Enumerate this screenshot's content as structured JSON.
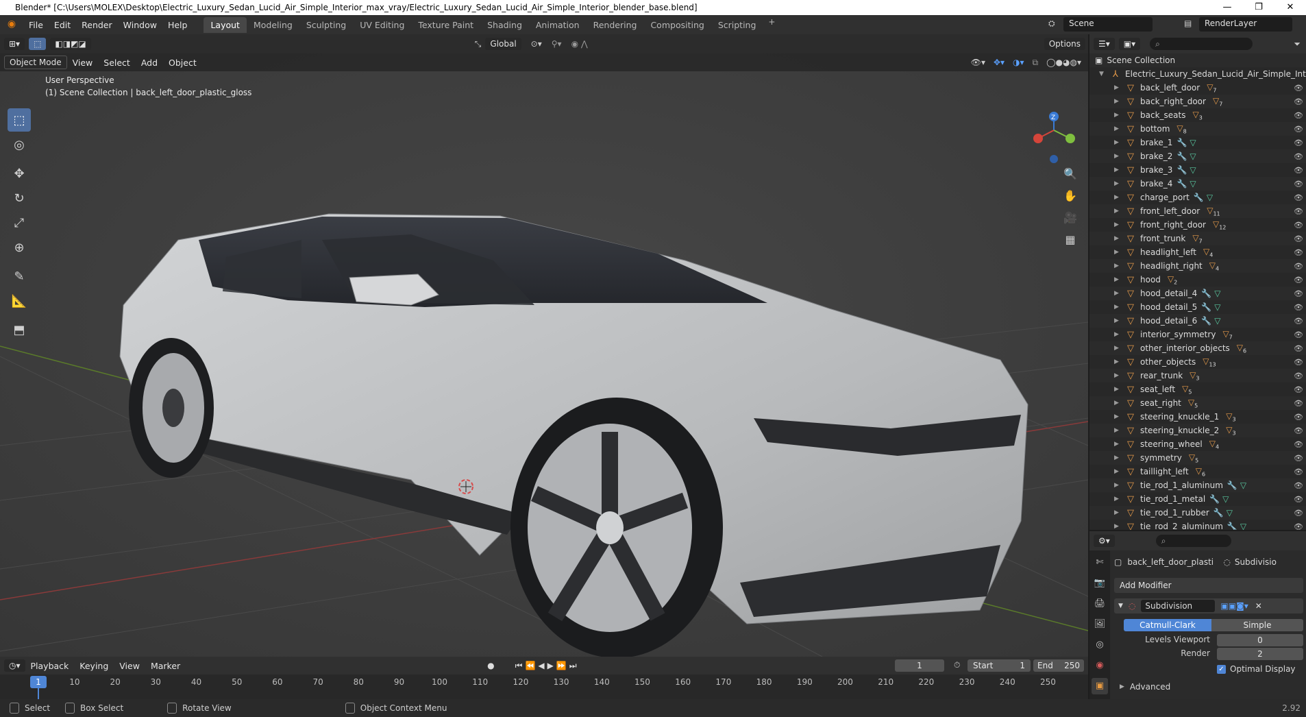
{
  "window": {
    "title": "Blender* [C:\\Users\\MOLEX\\Desktop\\Electric_Luxury_Sedan_Lucid_Air_Simple_Interior_max_vray/Electric_Luxury_Sedan_Lucid_Air_Simple_Interior_blender_base.blend]",
    "controls": [
      "—",
      "❐",
      "✕"
    ]
  },
  "menu": [
    "File",
    "Edit",
    "Render",
    "Window",
    "Help"
  ],
  "workspaces": [
    "Layout",
    "Modeling",
    "Sculpting",
    "UV Editing",
    "Texture Paint",
    "Shading",
    "Animation",
    "Rendering",
    "Compositing",
    "Scripting"
  ],
  "scene": {
    "name": "Scene",
    "render_layer": "RenderLayer"
  },
  "viewport": {
    "mode": "Object Mode",
    "menu": [
      "View",
      "Select",
      "Add",
      "Object"
    ],
    "orientation": "Global",
    "options": "Options",
    "perspective": "User Perspective",
    "collection_info": "(1) Scene Collection | back_left_door_plastic_gloss",
    "gizmo": {
      "z": "Z"
    }
  },
  "outliner": {
    "root": "Scene Collection",
    "collection": "Electric_Luxury_Sedan_Lucid_Air_Simple_Int",
    "items": [
      {
        "name": "back_left_door",
        "badge": "7"
      },
      {
        "name": "back_right_door",
        "badge": "7"
      },
      {
        "name": "back_seats",
        "badge": "3"
      },
      {
        "name": "bottom",
        "badge": "8"
      },
      {
        "name": "brake_1",
        "badge": ""
      },
      {
        "name": "brake_2",
        "badge": ""
      },
      {
        "name": "brake_3",
        "badge": ""
      },
      {
        "name": "brake_4",
        "badge": ""
      },
      {
        "name": "charge_port",
        "badge": ""
      },
      {
        "name": "front_left_door",
        "badge": "11"
      },
      {
        "name": "front_right_door",
        "badge": "12"
      },
      {
        "name": "front_trunk",
        "badge": "7"
      },
      {
        "name": "headlight_left",
        "badge": "4"
      },
      {
        "name": "headlight_right",
        "badge": "4"
      },
      {
        "name": "hood",
        "badge": "2"
      },
      {
        "name": "hood_detail_4",
        "badge": ""
      },
      {
        "name": "hood_detail_5",
        "badge": ""
      },
      {
        "name": "hood_detail_6",
        "badge": ""
      },
      {
        "name": "interior_symmetry",
        "badge": "7"
      },
      {
        "name": "other_interior_objects",
        "badge": "6"
      },
      {
        "name": "other_objects",
        "badge": "13"
      },
      {
        "name": "rear_trunk",
        "badge": "3"
      },
      {
        "name": "seat_left",
        "badge": "5"
      },
      {
        "name": "seat_right",
        "badge": "5"
      },
      {
        "name": "steering_knuckle_1",
        "badge": "3"
      },
      {
        "name": "steering_knuckle_2",
        "badge": "3"
      },
      {
        "name": "steering_wheel",
        "badge": "4"
      },
      {
        "name": "symmetry",
        "badge": "5"
      },
      {
        "name": "taillight_left",
        "badge": "6"
      },
      {
        "name": "tie_rod_1_aluminum",
        "badge": ""
      },
      {
        "name": "tie_rod_1_metal",
        "badge": ""
      },
      {
        "name": "tie_rod_1_rubber",
        "badge": ""
      },
      {
        "name": "tie_rod_2_aluminum",
        "badge": ""
      }
    ]
  },
  "properties": {
    "object_name": "back_left_door_plastic_...",
    "modifier_tab": "Subdivisio",
    "add_modifier": "Add Modifier",
    "modifier_name": "Subdivision",
    "type_a": "Catmull-Clark",
    "type_b": "Simple",
    "levels_viewport_label": "Levels Viewport",
    "levels_viewport": "0",
    "render_label": "Render",
    "render_levels": "2",
    "optimal_display": "Optimal Display",
    "advanced": "Advanced"
  },
  "timeline": {
    "menu": [
      "Playback",
      "Keying",
      "View",
      "Marker"
    ],
    "current_frame": "1",
    "start_label": "Start",
    "start": "1",
    "end_label": "End",
    "end": "250",
    "ticks": [
      "1",
      "10",
      "20",
      "30",
      "40",
      "50",
      "60",
      "70",
      "80",
      "90",
      "100",
      "110",
      "120",
      "130",
      "140",
      "150",
      "160",
      "170",
      "180",
      "190",
      "200",
      "210",
      "220",
      "230",
      "240",
      "250"
    ]
  },
  "statusbar": {
    "select": "Select",
    "box_select": "Box Select",
    "rotate_view": "Rotate View",
    "context_menu": "Object Context Menu",
    "version": "2.92"
  }
}
